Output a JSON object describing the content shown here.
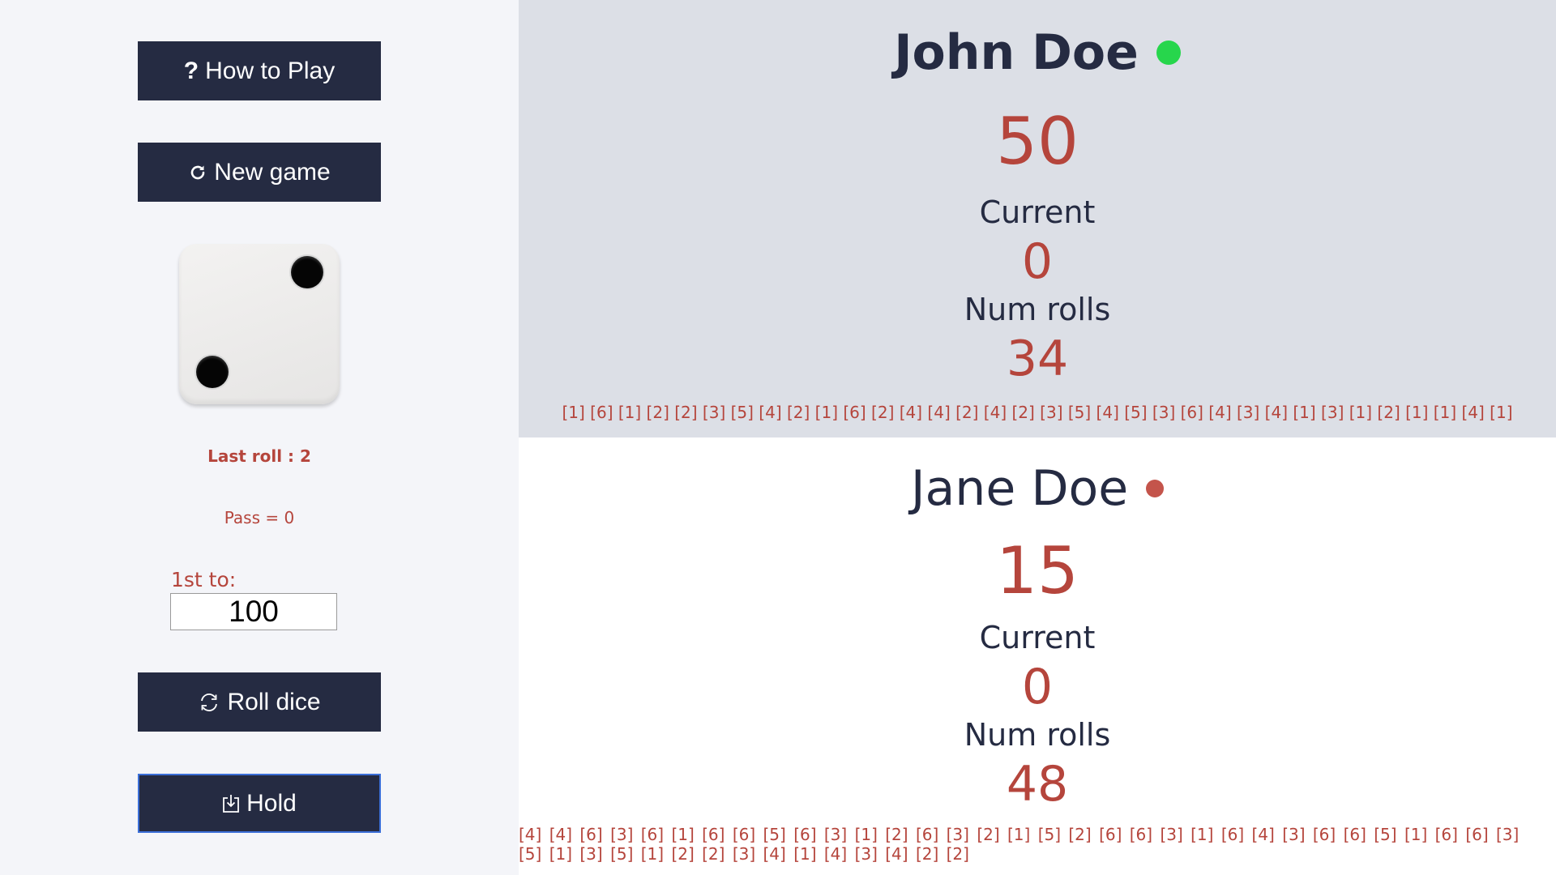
{
  "sidebar": {
    "how_to_play": {
      "icon": "question-icon",
      "glyph": "?",
      "label": "How to Play"
    },
    "new_game": {
      "icon": "refresh-icon",
      "glyph": "⟳",
      "label": "New game"
    },
    "dice": {
      "value": 2,
      "icon": "die-face-two-icon"
    },
    "last_roll": "Last roll : 2",
    "pass": "Pass = 0",
    "first_to_label": "1st to:",
    "first_to_value": "100",
    "roll_dice": {
      "icon": "roll-dice-icon",
      "label": "Roll dice"
    },
    "hold": {
      "icon": "hold-icon",
      "label": "Hold"
    }
  },
  "players": [
    {
      "name": "John Doe",
      "active": true,
      "score": "50",
      "current_label": "Current",
      "current": "0",
      "rolls_label": "Num rolls",
      "num_rolls": "34",
      "history": "[1] [6] [1] [2] [2] [3] [5] [4] [2] [1] [6] [2] [4] [4] [2] [4] [2] [3] [5] [4] [5] [3] [6] [4] [3] [4] [1] [3] [1] [2] [1] [1] [4] [1]"
    },
    {
      "name": "Jane Doe",
      "active": false,
      "score": "15",
      "current_label": "Current",
      "current": "0",
      "rolls_label": "Num rolls",
      "num_rolls": "48",
      "history": "[4] [4] [6] [3] [6] [1] [6] [6] [5] [6] [3] [1] [2] [6] [3] [2] [1] [5] [2] [6] [6] [3] [1] [6] [4] [3] [6] [6] [5] [1] [6] [6] [3] [5] [1] [3] [5] [1] [2] [2] [3] [4] [1] [4] [3] [4] [2] [2]"
    }
  ],
  "colors": {
    "button_bg": "#252b42",
    "accent_red": "#b5453c",
    "active_dot": "#27d64c",
    "inactive_dot": "#c4544b",
    "active_panel_bg": "#dcdfe6",
    "inactive_panel_bg": "#ffffff"
  }
}
